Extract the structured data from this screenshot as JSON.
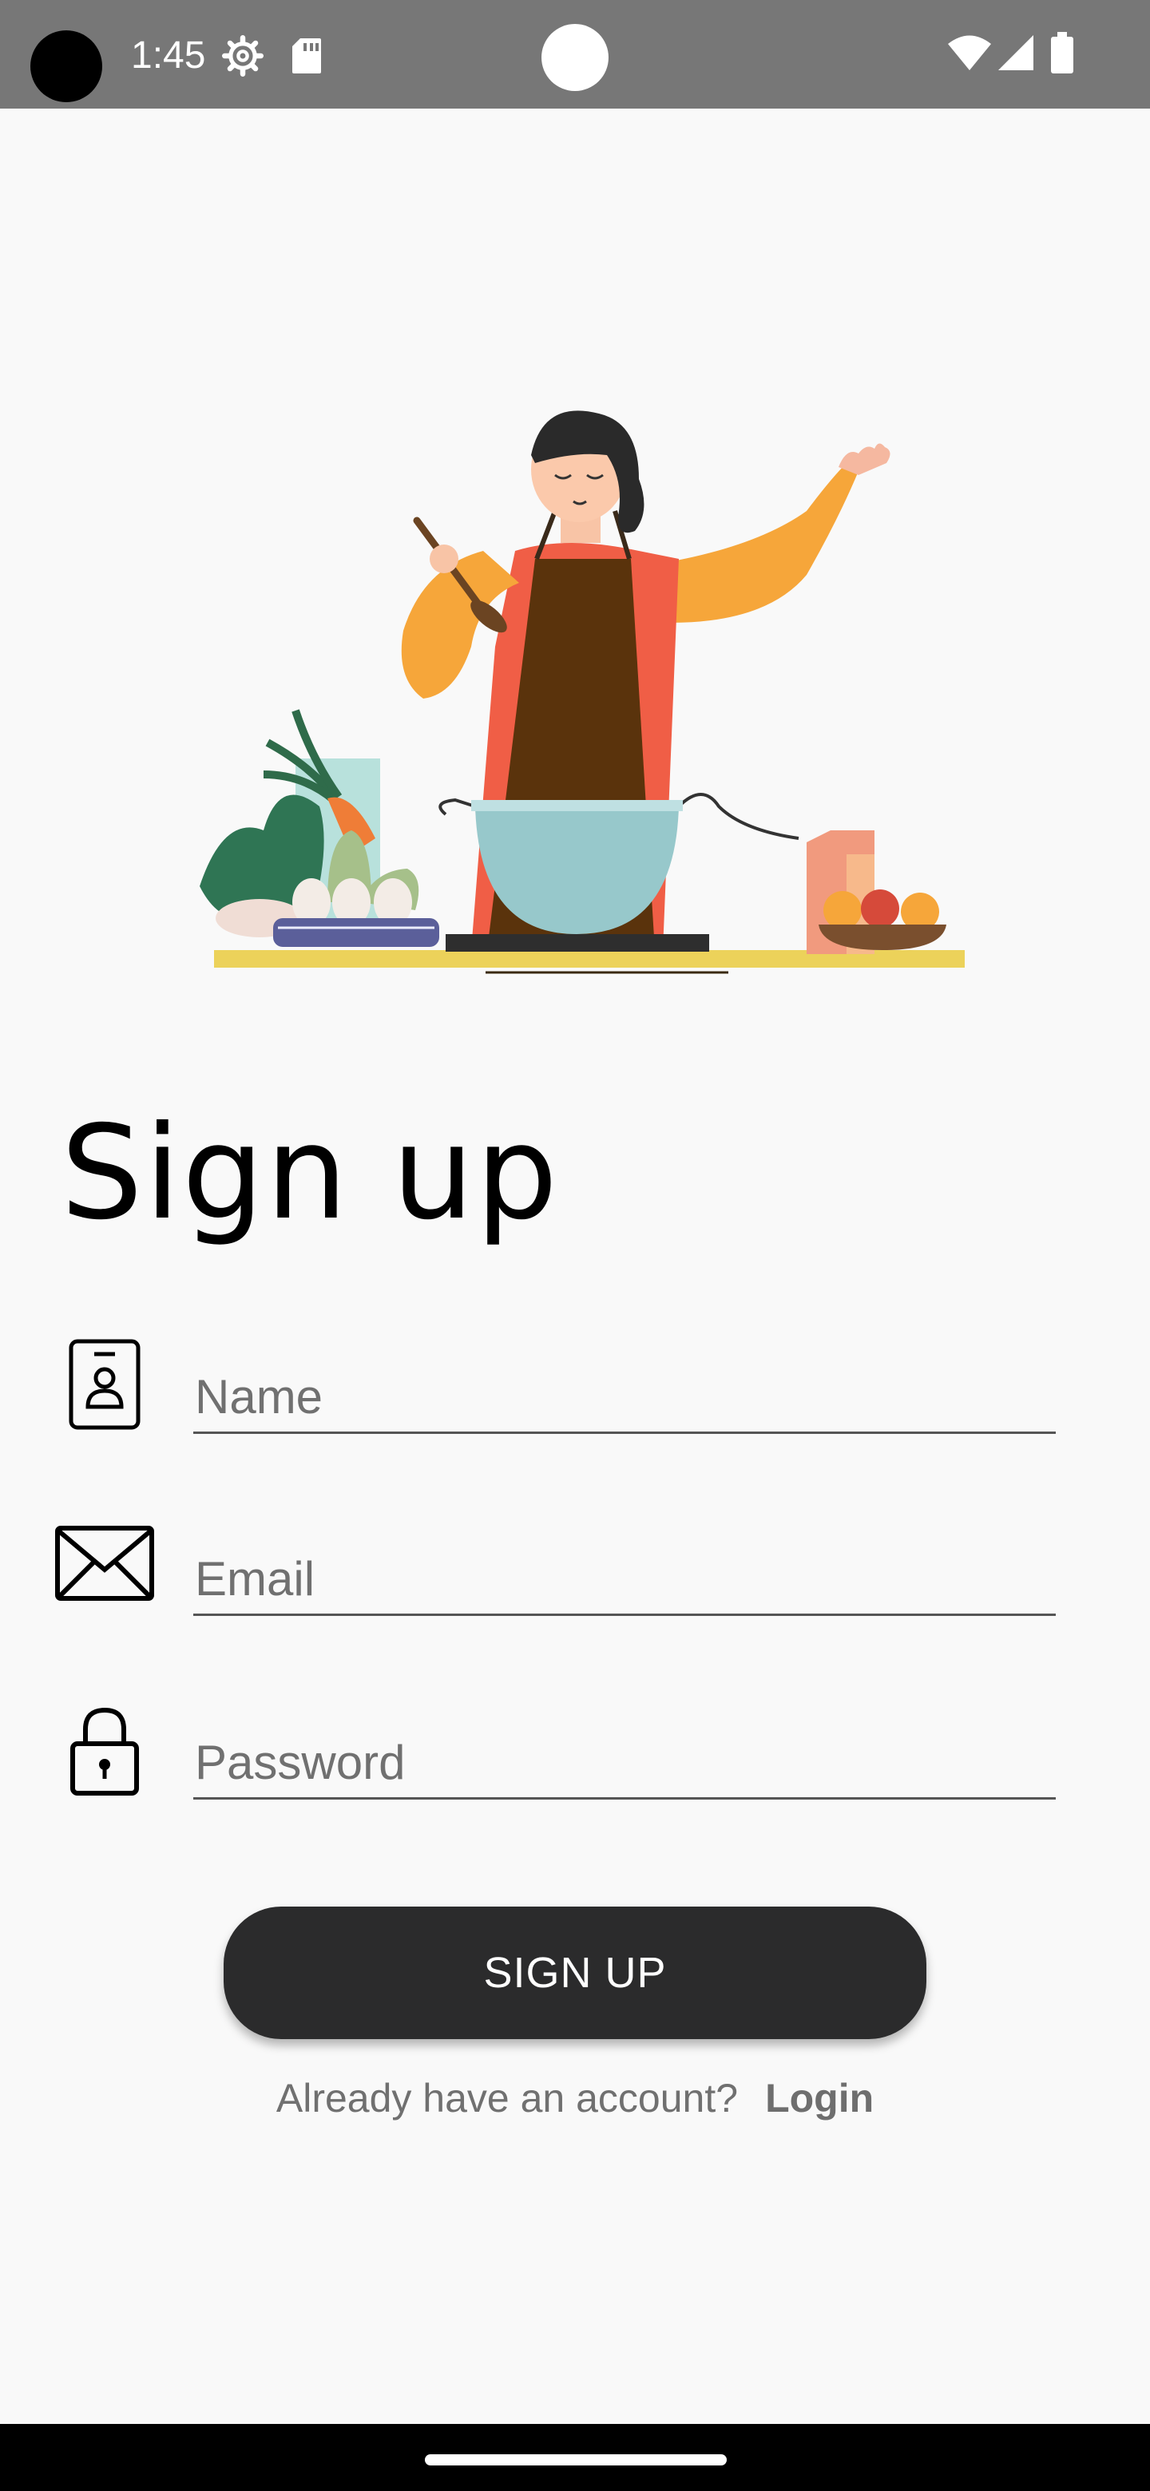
{
  "status_bar": {
    "time": "1:45",
    "icons": [
      "settings-gear-icon",
      "sd-card-icon",
      "wifi-icon",
      "cell-signal-icon",
      "battery-icon"
    ],
    "background": "#777777"
  },
  "hero": {
    "icon": "chef-cooking-illustration"
  },
  "page": {
    "title": "Sign up"
  },
  "form": {
    "name_placeholder": "Name",
    "email_placeholder": "Email",
    "password_placeholder": "Password",
    "name_icon": "id-badge-icon",
    "email_icon": "envelope-icon",
    "password_icon": "lock-icon"
  },
  "actions": {
    "signup_label": "SIGN UP",
    "button_color": "#2b2b2c"
  },
  "footer": {
    "question": "Already have an account?",
    "login_label": "Login"
  }
}
